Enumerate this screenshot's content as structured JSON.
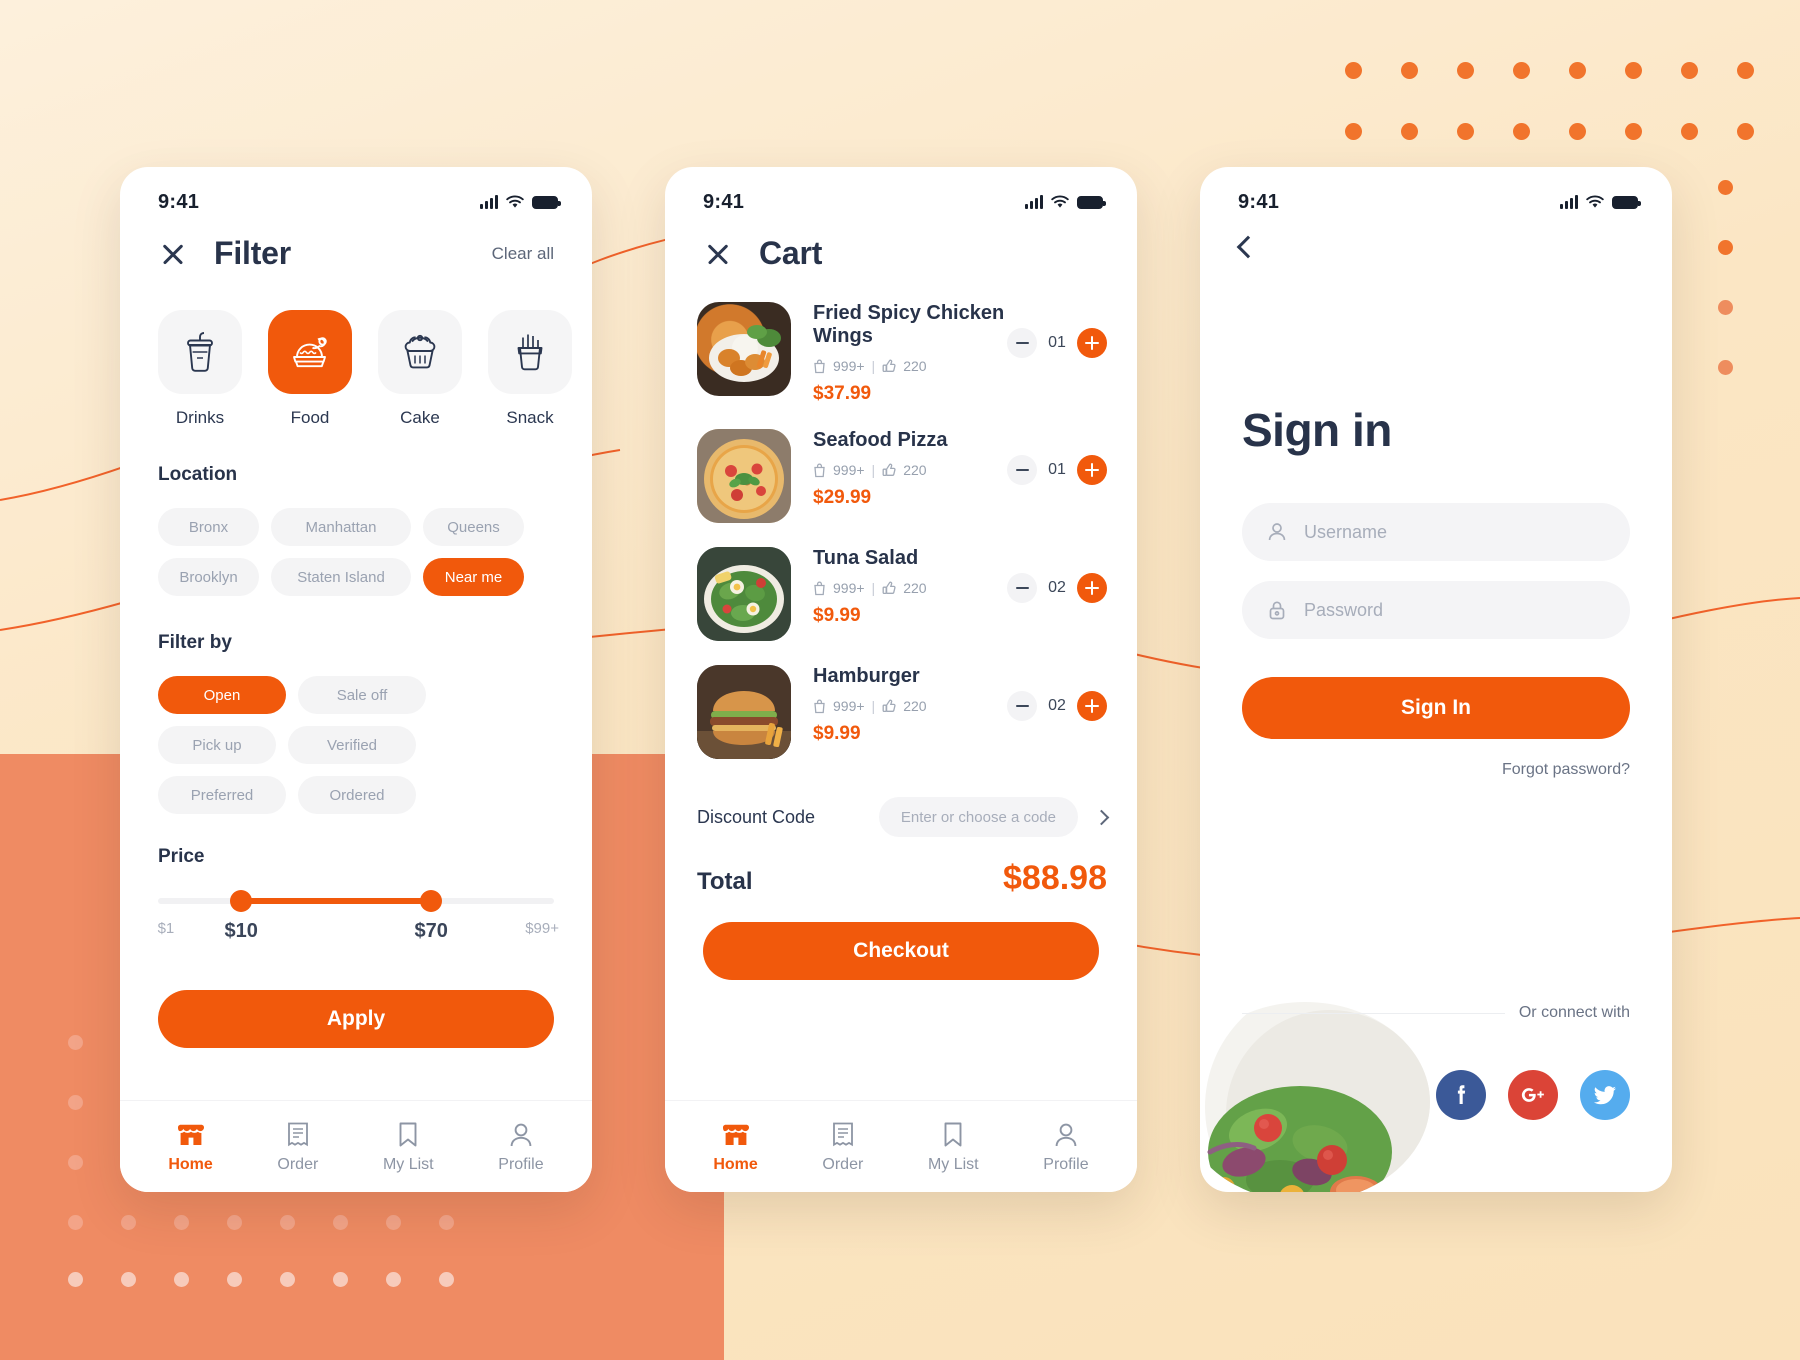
{
  "brand": {
    "accent": "#f1590c",
    "dark": "#28334a",
    "muted": "#9aa2b1",
    "chip_bg": "#f4f4f5"
  },
  "status_bar": {
    "time": "9:41",
    "signal_icon": "cellular-signal-icon",
    "wifi_icon": "wifi-icon",
    "battery_icon": "battery-icon"
  },
  "filter_screen": {
    "title": "Filter",
    "close_icon": "close-icon",
    "clear_all": "Clear all",
    "categories": [
      {
        "label": "Drinks",
        "icon": "drink-cup-icon",
        "active": false
      },
      {
        "label": "Food",
        "icon": "roast-chicken-icon",
        "active": true
      },
      {
        "label": "Cake",
        "icon": "cupcake-icon",
        "active": false
      },
      {
        "label": "Snack",
        "icon": "fries-icon",
        "active": false
      }
    ],
    "location": {
      "title": "Location",
      "chips": [
        {
          "label": "Bronx",
          "selected": false
        },
        {
          "label": "Manhattan",
          "selected": false
        },
        {
          "label": "Queens",
          "selected": false
        },
        {
          "label": "Brooklyn",
          "selected": false
        },
        {
          "label": "Staten Island",
          "selected": false
        },
        {
          "label": "Near me",
          "selected": true
        }
      ]
    },
    "filter_by": {
      "title": "Filter by",
      "chips": [
        {
          "label": "Open",
          "selected": true
        },
        {
          "label": "Sale off",
          "selected": false
        },
        {
          "label": "Pick up",
          "selected": false
        },
        {
          "label": "Verified",
          "selected": false
        },
        {
          "label": "Preferred",
          "selected": false
        },
        {
          "label": "Ordered",
          "selected": false
        }
      ]
    },
    "price": {
      "title": "Price",
      "min_label": "$1",
      "max_label": "$99+",
      "low_value": "$10",
      "high_value": "$70",
      "low_pct": 21,
      "high_pct": 69
    },
    "apply_button": "Apply"
  },
  "cart_screen": {
    "title": "Cart",
    "close_icon": "close-icon",
    "items": [
      {
        "name": "Fried Spicy Chicken Wings",
        "orders": "999+",
        "likes": "220",
        "price": "$37.99",
        "qty": "01",
        "image": "fried-chicken-wings-photo"
      },
      {
        "name": "Seafood Pizza",
        "orders": "999+",
        "likes": "220",
        "price": "$29.99",
        "qty": "01",
        "image": "seafood-pizza-photo"
      },
      {
        "name": "Tuna Salad",
        "orders": "999+",
        "likes": "220",
        "price": "$9.99",
        "qty": "02",
        "image": "tuna-salad-photo"
      },
      {
        "name": "Hamburger",
        "orders": "999+",
        "likes": "220",
        "price": "$9.99",
        "qty": "02",
        "image": "hamburger-photo"
      }
    ],
    "meta_separator": "|",
    "orders_icon": "shopping-bag-icon",
    "likes_icon": "thumbs-up-icon",
    "discount_label": "Discount Code",
    "discount_placeholder": "Enter or choose a code",
    "discount_value": "",
    "total_label": "Total",
    "total_value": "$88.98",
    "checkout_button": "Checkout"
  },
  "signin_screen": {
    "back_icon": "back-arrow-icon",
    "title": "Sign in",
    "username": {
      "placeholder": "Username",
      "value": "",
      "icon": "person-icon"
    },
    "password": {
      "placeholder": "Password",
      "value": "",
      "icon": "lock-icon"
    },
    "signin_button": "Sign In",
    "forgot_password": "Forgot password?",
    "connect_text": "Or connect with",
    "socials": [
      {
        "name": "facebook",
        "glyph": "f",
        "color": "#3b5998"
      },
      {
        "name": "google-plus",
        "glyph": "G+",
        "color": "#db4437"
      },
      {
        "name": "twitter",
        "glyph": "twitter-bird",
        "color": "#55acee"
      }
    ],
    "decor_image": "salad-bowl-photo"
  },
  "bottom_nav": [
    {
      "label": "Home",
      "icon": "store-icon",
      "active": true
    },
    {
      "label": "Order",
      "icon": "receipt-icon",
      "active": false
    },
    {
      "label": "My List",
      "icon": "bookmark-icon",
      "active": false
    },
    {
      "label": "Profile",
      "icon": "person-icon",
      "active": false
    }
  ]
}
